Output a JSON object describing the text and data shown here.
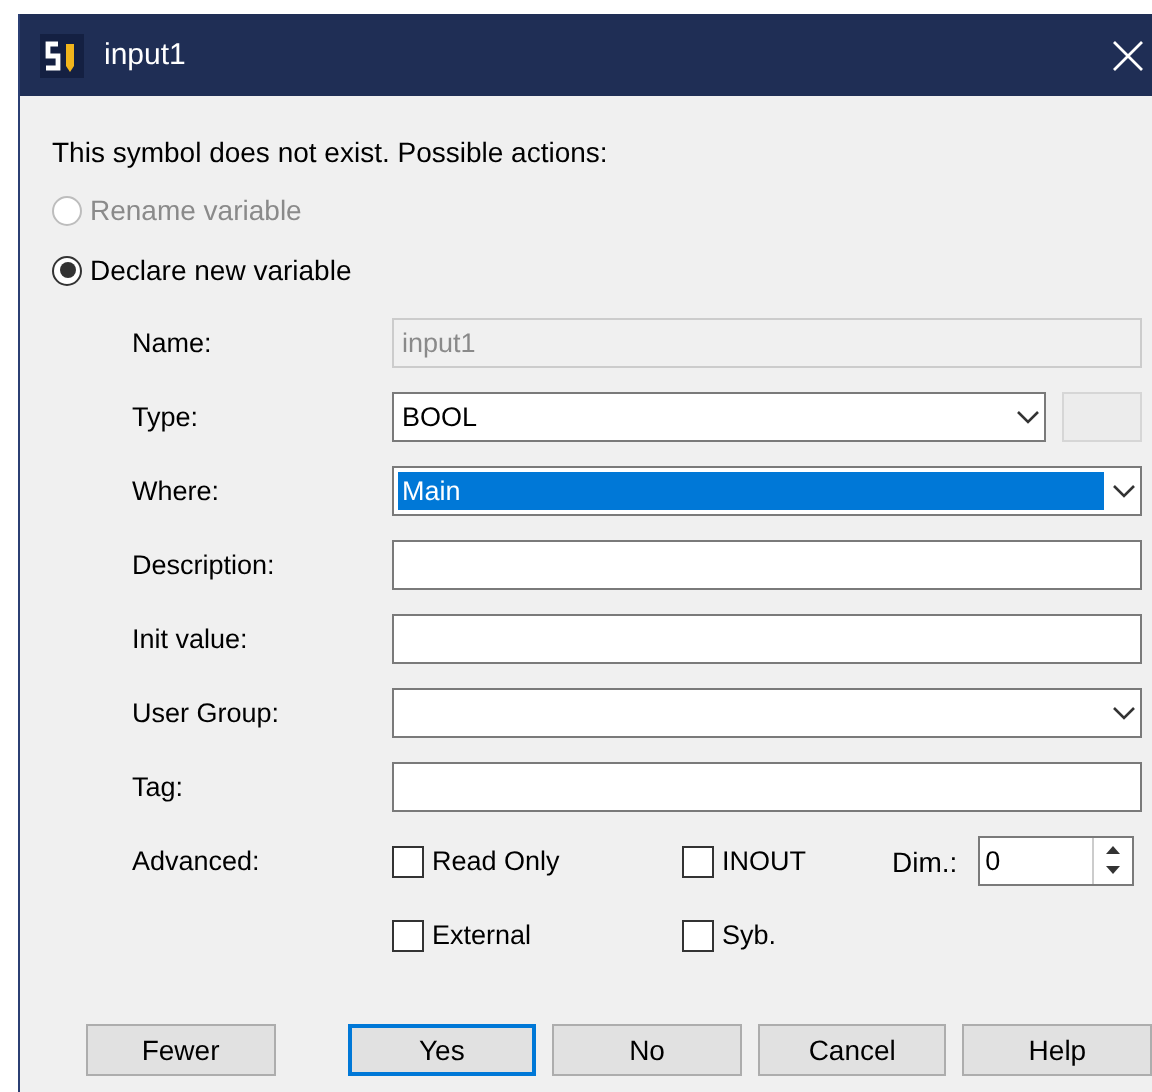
{
  "window": {
    "title": "input1"
  },
  "message": "This symbol does not exist. Possible actions:",
  "actions": [
    {
      "label": "Rename variable",
      "selected": false,
      "disabled": true
    },
    {
      "label": "Declare new variable",
      "selected": true,
      "disabled": false
    }
  ],
  "fields": [
    {
      "label": "Name:",
      "kind": "text",
      "value": "input1",
      "disabled": true
    },
    {
      "label": "Type:",
      "kind": "dropdown-button",
      "value": "BOOL"
    },
    {
      "label": "Where:",
      "kind": "dropdown",
      "value": "Main",
      "highlighted": true
    },
    {
      "label": "Description:",
      "kind": "text",
      "disabled": false
    },
    {
      "label": "Init value:",
      "kind": "text",
      "disabled": false
    },
    {
      "label": "User Group:",
      "kind": "dropdown"
    },
    {
      "label": "Tag:",
      "kind": "text",
      "disabled": false
    }
  ],
  "advanced": {
    "label": "Advanced:",
    "checkboxes": [
      {
        "label": "Read Only",
        "checked": false
      },
      {
        "label": "INOUT",
        "checked": false
      },
      {
        "label": "External",
        "checked": false
      },
      {
        "label": "Syb.",
        "checked": false
      }
    ],
    "dim_label": "Dim.:",
    "dim_value": "0"
  },
  "buttons": [
    {
      "label": "Fewer",
      "selected": false
    },
    {
      "label": "Yes",
      "selected": true
    },
    {
      "label": "No",
      "selected": false
    },
    {
      "label": "Cancel",
      "selected": false
    },
    {
      "label": "Help",
      "selected": false
    }
  ]
}
